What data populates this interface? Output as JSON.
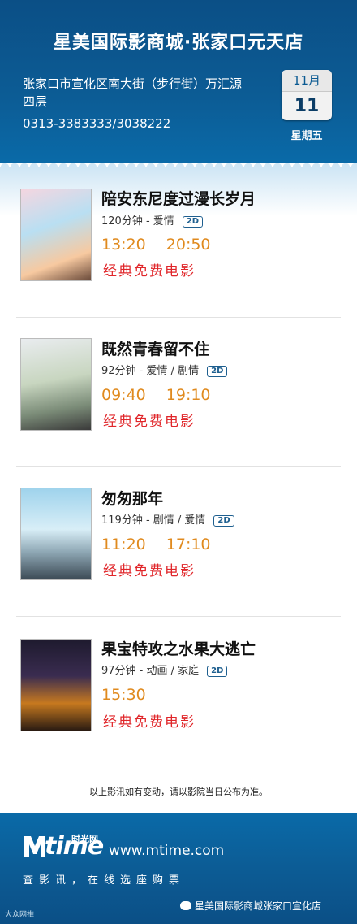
{
  "header": {
    "cinema_name": "星美国际影商城·张家口元天店",
    "address_line1": "张家口市宣化区南大街（步行街）万汇源",
    "address_line2": "四层",
    "phone": "0313-3383333/3038222",
    "month": "11月",
    "day": "11",
    "weekday": "星期五"
  },
  "movies": [
    {
      "title": "陪安东尼度过漫长岁月",
      "meta": "120分钟 - 爱情",
      "format": "2D",
      "times": [
        "13:20",
        "20:50"
      ],
      "note": "经典免费电影"
    },
    {
      "title": "既然青春留不住",
      "meta": "92分钟 - 爱情 / 剧情",
      "format": "2D",
      "times": [
        "09:40",
        "19:10"
      ],
      "note": "经典免费电影"
    },
    {
      "title": "匆匆那年",
      "meta": "119分钟 - 剧情 / 爱情",
      "format": "2D",
      "times": [
        "11:20",
        "17:10"
      ],
      "note": "经典免费电影"
    },
    {
      "title": "果宝特攻之水果大逃亡",
      "meta": "97分钟 - 动画 / 家庭",
      "format": "2D",
      "times": [
        "15:30"
      ],
      "note": "经典免费电影"
    }
  ],
  "disclaimer": "以上影讯如有变动，请以影院当日公布为准。",
  "footer": {
    "logo_text": "time",
    "logo_cn": "时光网",
    "url": "www.mtime.com",
    "slogan": "查影讯，在线选座购票",
    "watermark_left": "大众网推",
    "watermark_right": "星美国际影商城张家口宣化店"
  }
}
